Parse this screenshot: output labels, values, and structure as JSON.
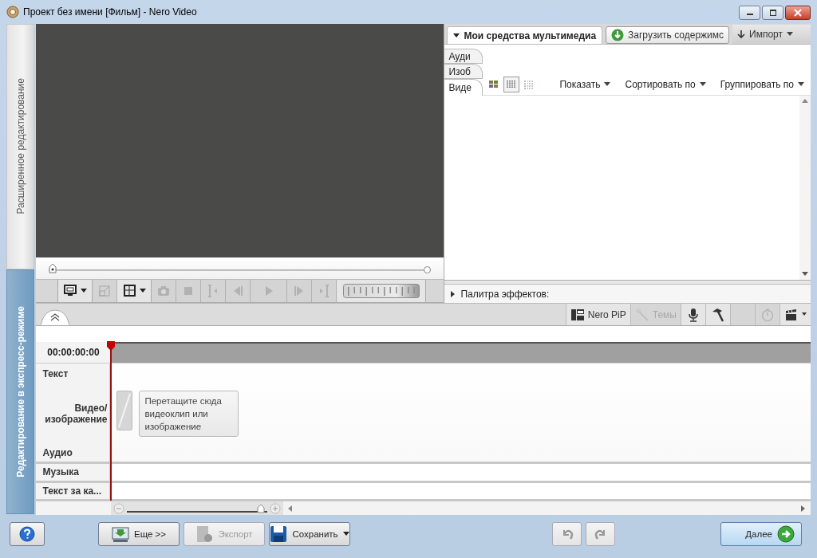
{
  "window": {
    "title": "Проект без имени [Фильм] - Nero Video"
  },
  "sidebar": {
    "tabs": [
      {
        "label": "Расширенное редактирование",
        "selected": false
      },
      {
        "label": "Редактирование в экспресс-режиме",
        "selected": true
      }
    ]
  },
  "preview": {
    "position": {
      "level": 0
    },
    "controls": [
      {
        "kind": "screen",
        "dropdown": true,
        "disabled": false
      },
      {
        "kind": "resize",
        "dropdown": false,
        "disabled": true
      },
      {
        "kind": "frame",
        "dropdown": true,
        "disabled": false
      },
      {
        "kind": "camera",
        "dropdown": false,
        "disabled": true
      },
      {
        "kind": "stop",
        "dropdown": false,
        "disabled": true
      },
      {
        "kind": "mark-in",
        "dropdown": false,
        "disabled": true
      },
      {
        "kind": "prev",
        "dropdown": false,
        "disabled": true
      },
      {
        "kind": "play",
        "dropdown": false,
        "disabled": true
      },
      {
        "kind": "next",
        "dropdown": false,
        "disabled": true
      },
      {
        "kind": "mark-out",
        "dropdown": false,
        "disabled": true
      },
      {
        "kind": "jog",
        "disabled": true
      }
    ]
  },
  "media": {
    "title": "Мои средства мультимедиа",
    "load_button": "Загрузить содержимс",
    "import_button": "Импорт",
    "tabs": [
      {
        "label": "Ауди",
        "selected": false
      },
      {
        "label": "Изоб",
        "selected": false
      },
      {
        "label": "Виде",
        "selected": true
      }
    ],
    "views": [
      {
        "kind": "tiles",
        "selected": false
      },
      {
        "kind": "grid",
        "selected": true
      },
      {
        "kind": "details",
        "selected": false
      }
    ],
    "menus": [
      "Показать",
      "Сортировать по",
      "Группировать по"
    ]
  },
  "effects": {
    "title": "Палитра эффектов:",
    "expanded": false
  },
  "toolbar": [
    {
      "kind": "pip",
      "label": "Nero PiP",
      "disabled": false
    },
    {
      "kind": "themes",
      "label": "Темы",
      "disabled": true
    },
    {
      "kind": "mic",
      "disabled": false
    },
    {
      "kind": "hammer",
      "disabled": false
    },
    {
      "kind": "blank",
      "disabled": true
    },
    {
      "kind": "timer",
      "disabled": true
    },
    {
      "kind": "clapper",
      "disabled": false
    }
  ],
  "timeline": {
    "timecode": "00:00:00:00",
    "tracks": [
      {
        "label": "Текст",
        "kind": "main"
      },
      {
        "label": "Видео/ изображение",
        "kind": "main"
      },
      {
        "label": "Аудио",
        "kind": "main"
      },
      {
        "label": "Музыка",
        "kind": "lane"
      },
      {
        "label": "Текст за ка...",
        "kind": "lane"
      }
    ],
    "drop_hint": "Перетащите сюда видеоклип или изображение",
    "zoom": {
      "level": 0.98
    }
  },
  "footer": {
    "buttons": [
      {
        "kind": "more",
        "label": "Еще >>",
        "disabled": false
      },
      {
        "kind": "export",
        "label": "Экспорт",
        "disabled": true
      },
      {
        "kind": "save",
        "label": "Сохранить",
        "disabled": false
      }
    ],
    "undo_disabled": true,
    "redo_disabled": true,
    "next_button": "Далее"
  }
}
